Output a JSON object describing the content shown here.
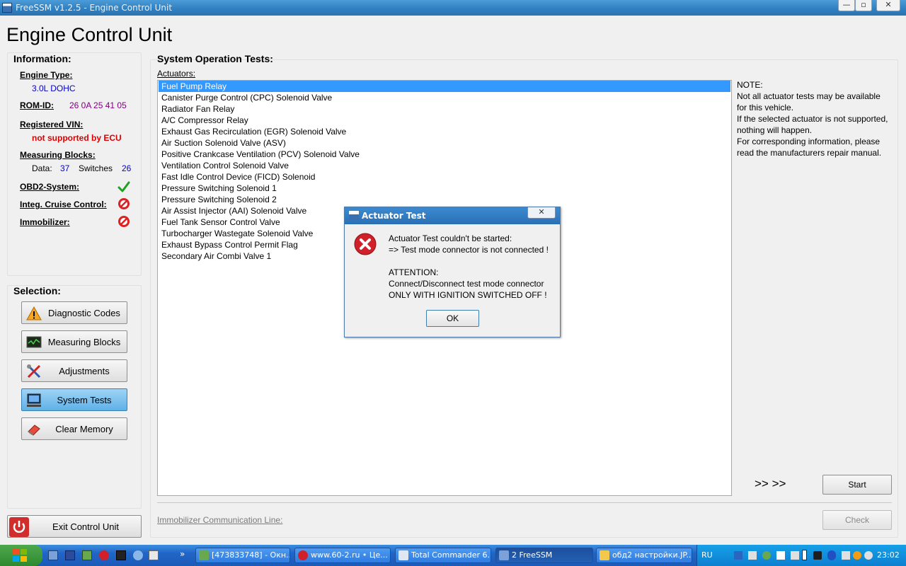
{
  "window": {
    "title": "FreeSSM v1.2.5 - Engine Control Unit",
    "min": "—",
    "max": "▫",
    "close": "✕"
  },
  "page_title": "Engine Control Unit",
  "information": {
    "title": "Information:",
    "engine_type_label": "Engine Type:",
    "engine_type_value": "3.0L DOHC",
    "romid_label": "ROM-ID:",
    "romid_value": "26 0A 25 41 05",
    "vin_label": "Registered VIN:",
    "vin_value": "not supported by ECU",
    "blocks_label": "Measuring Blocks:",
    "data_label": "Data:",
    "data_value": "37",
    "switches_label": "Switches",
    "switches_value": "26",
    "obd2_label": "OBD2-System:",
    "cruise_label": "Integ. Cruise Control:",
    "immobilizer_label": "Immobilizer:"
  },
  "selection": {
    "title": "Selection:",
    "buttons": [
      {
        "label": "Diagnostic Codes",
        "icon": "warning-icon"
      },
      {
        "label": "Measuring Blocks",
        "icon": "monitor-graph-icon"
      },
      {
        "label": "Adjustments",
        "icon": "tools-icon"
      },
      {
        "label": "System Tests",
        "icon": "computer-icon"
      },
      {
        "label": "Clear Memory",
        "icon": "eraser-icon"
      }
    ],
    "exit_label": "Exit Control Unit"
  },
  "tests": {
    "title": "System Operation Tests:",
    "actuators_label": "Actuators:",
    "actuators": [
      "Fuel Pump Relay",
      "Canister Purge Control (CPC) Solenoid Valve",
      "Radiator Fan Relay",
      "A/C Compressor Relay",
      "Exhaust Gas Recirculation (EGR) Solenoid Valve",
      "Air Suction Solenoid Valve (ASV)",
      "Positive Crankcase Ventilation (PCV) Solenoid Valve",
      "Ventilation Control Solenoid Valve",
      "Fast Idle Control Device (FICD) Solenoid",
      "Pressure Switching Solenoid 1",
      "Pressure Switching Solenoid 2",
      "Air Assist Injector (AAI) Solenoid Valve",
      "Fuel Tank Sensor Control Valve",
      "Turbocharger Wastegate Solenoid Valve",
      "Exhaust Bypass Control Permit Flag",
      "Secondary Air Combi Valve 1"
    ],
    "selected_index": 0,
    "note_lines": [
      "NOTE:",
      "Not all actuator tests may be available",
      "for this vehicle.",
      "If the selected actuator is not supported,",
      "nothing will happen.",
      "For corresponding information, please",
      "read the manufacturers repair manual."
    ],
    "arrows": ">> >>",
    "start_label": "Start",
    "immo_line_label": "Immobilizer Communication Line:",
    "check_label": "Check"
  },
  "dialog": {
    "title": "Actuator Test",
    "close": "✕",
    "lines": [
      "Actuator Test couldn't be started:",
      "=> Test mode connector is not connected !",
      "",
      "ATTENTION:",
      "Connect/Disconnect test mode connector",
      "ONLY WITH IGNITION SWITCHED OFF !"
    ],
    "ok_label": "OK"
  },
  "taskbar": {
    "tasks": [
      "[473833748] - Окн...",
      "www.60-2.ru • Це...",
      "Total Commander 6...",
      "2 FreeSSM",
      "обд2 настройки.JP..."
    ],
    "lang": "RU",
    "clock": "23:02",
    "expand": "»"
  },
  "colors": {
    "accent": "#3399ff",
    "value_blue": "#0000cc",
    "romid_purple": "#800080",
    "error_red": "#dd0000",
    "ok_green": "#22a022"
  }
}
